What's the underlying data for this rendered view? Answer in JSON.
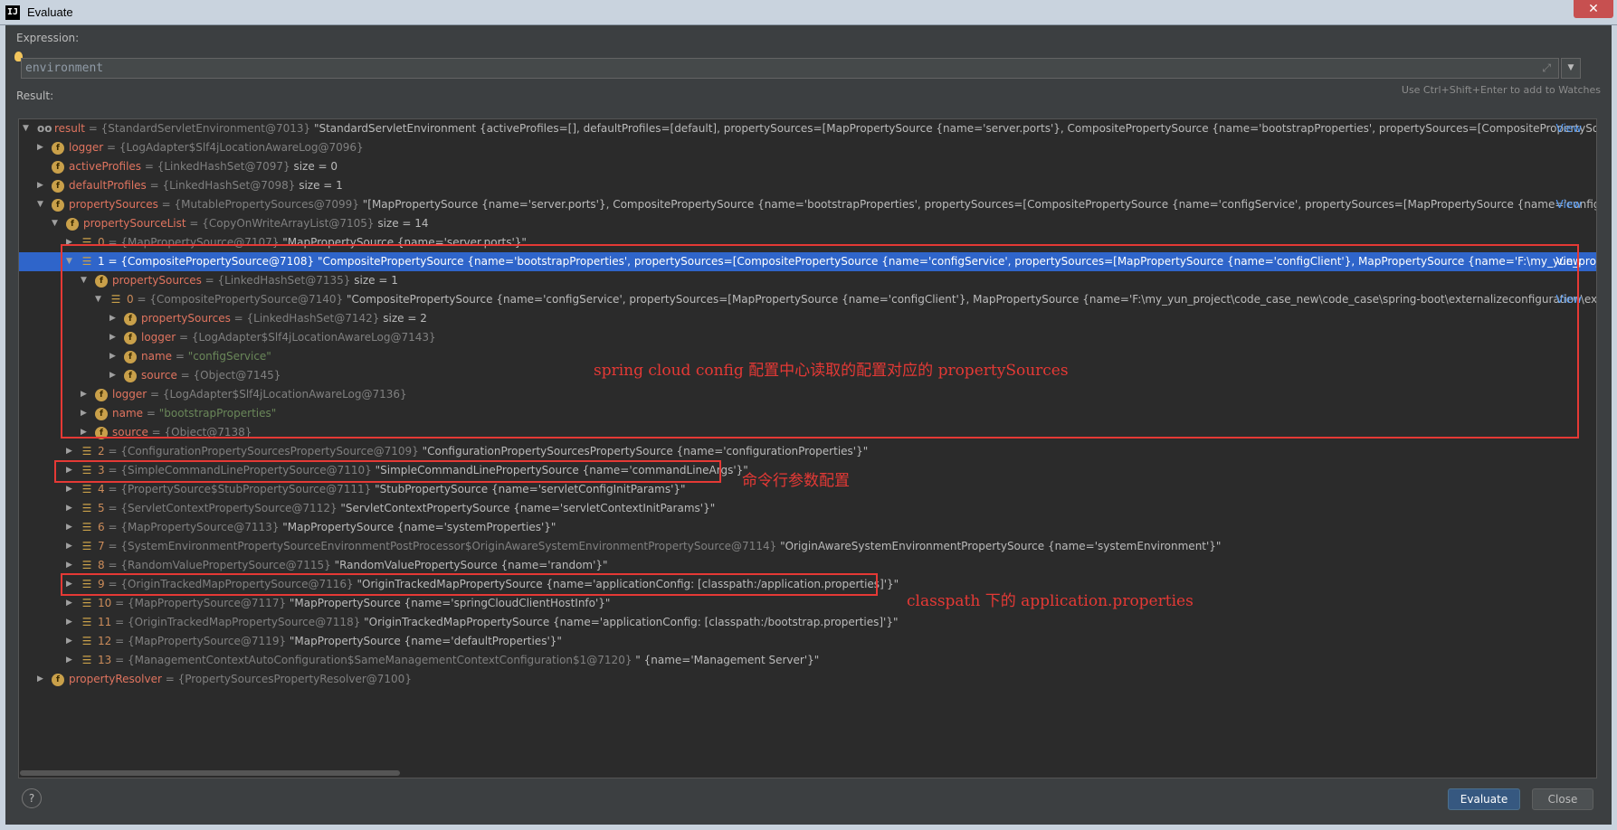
{
  "window": {
    "title": "Evaluate",
    "app_icon": "IJ",
    "close": "✕"
  },
  "expression": {
    "label": "Expression:",
    "value": "environment",
    "hint": "Use Ctrl+Shift+Enter to add to Watches"
  },
  "result_label": "Result:",
  "view_link": "View",
  "rows": [
    {
      "icon": "oo",
      "text_name": "result",
      "text_type": " = {StandardServletEnvironment@7013} ",
      "text_value": "\"StandardServletEnvironment {activeProfiles=[], defaultProfiles=[default], propertySources=[MapPropertySource {name='server.ports'}, CompositePropertySource {name='bootstrapProperties', propertySources=[CompositePropertySource {r...",
      "view": true
    },
    {
      "icon": "f",
      "text_name": "logger",
      "text_type": " = {LogAdapter$Slf4jLocationAwareLog@7096}",
      "text_value": ""
    },
    {
      "icon": "f",
      "text_name": "activeProfiles",
      "text_type": " = {LinkedHashSet@7097} ",
      "text_value": " size = 0"
    },
    {
      "icon": "f",
      "text_name": "defaultProfiles",
      "text_type": " = {LinkedHashSet@7098} ",
      "text_value": " size = 1"
    },
    {
      "icon": "f",
      "text_name": "propertySources",
      "text_type": " = {MutablePropertySources@7099} ",
      "text_value": "\"[MapPropertySource {name='server.ports'}, CompositePropertySource {name='bootstrapProperties', propertySources=[CompositePropertySource {name='configService', propertySources=[MapPropertySource {name='configClie...",
      "view": true
    },
    {
      "icon": "f",
      "text_name": "propertySourceList",
      "text_type": " = {CopyOnWriteArrayList@7105} ",
      "text_value": " size = 14"
    },
    {
      "icon": "=",
      "text_name": "0",
      "text_type": " = {MapPropertySource@7107} ",
      "text_value": "\"MapPropertySource {name='server.ports'}\""
    },
    {
      "icon": "=",
      "text_name": "1",
      "text_type": " = {CompositePropertySource@7108} ",
      "text_value": "\"CompositePropertySource {name='bootstrapProperties', propertySources=[CompositePropertySource {name='configService', propertySources=[MapPropertySource {name='configClient'}, MapPropertySource {name='F:\\my_yun_project\\...",
      "view": true
    },
    {
      "icon": "f",
      "text_name": "propertySources",
      "text_type": " = {LinkedHashSet@7135} ",
      "text_value": " size = 1"
    },
    {
      "icon": "=",
      "text_name": "0",
      "text_type": " = {CompositePropertySource@7140} ",
      "text_value": "\"CompositePropertySource {name='configService', propertySources=[MapPropertySource {name='configClient'}, MapPropertySource {name='F:\\my_yun_project\\code_case_new\\code_case\\spring-boot\\externalizeconfiguration\\ext-c...",
      "view": true
    },
    {
      "icon": "f",
      "text_name": "propertySources",
      "text_type": " = {LinkedHashSet@7142} ",
      "text_value": " size = 2"
    },
    {
      "icon": "f",
      "text_name": "logger",
      "text_type": " = {LogAdapter$Slf4jLocationAwareLog@7143}",
      "text_value": ""
    },
    {
      "icon": "f",
      "text_name": "name",
      "text_type": " = ",
      "text_value": "\"configService\""
    },
    {
      "icon": "f",
      "text_name": "source",
      "text_type": " = {Object@7145}",
      "text_value": ""
    },
    {
      "icon": "f",
      "text_name": "logger",
      "text_type": " = {LogAdapter$Slf4jLocationAwareLog@7136}",
      "text_value": ""
    },
    {
      "icon": "f",
      "text_name": "name",
      "text_type": " = ",
      "text_value": "\"bootstrapProperties\""
    },
    {
      "icon": "f",
      "text_name": "source",
      "text_type": " = {Object@7138}",
      "text_value": ""
    },
    {
      "icon": "=",
      "text_name": "2",
      "text_type": " = {ConfigurationPropertySourcesPropertySource@7109} ",
      "text_value": "\"ConfigurationPropertySourcesPropertySource {name='configurationProperties'}\""
    },
    {
      "icon": "=",
      "text_name": "3",
      "text_type": " = {SimpleCommandLinePropertySource@7110} ",
      "text_value": "\"SimpleCommandLinePropertySource {name='commandLineArgs'}\""
    },
    {
      "icon": "=",
      "text_name": "4",
      "text_type": " = {PropertySource$StubPropertySource@7111} ",
      "text_value": "\"StubPropertySource {name='servletConfigInitParams'}\""
    },
    {
      "icon": "=",
      "text_name": "5",
      "text_type": " = {ServletContextPropertySource@7112} ",
      "text_value": "\"ServletContextPropertySource {name='servletContextInitParams'}\""
    },
    {
      "icon": "=",
      "text_name": "6",
      "text_type": " = {MapPropertySource@7113} ",
      "text_value": "\"MapPropertySource {name='systemProperties'}\""
    },
    {
      "icon": "=",
      "text_name": "7",
      "text_type": " = {SystemEnvironmentPropertySourceEnvironmentPostProcessor$OriginAwareSystemEnvironmentPropertySource@7114} ",
      "text_value": "\"OriginAwareSystemEnvironmentPropertySource {name='systemEnvironment'}\""
    },
    {
      "icon": "=",
      "text_name": "8",
      "text_type": " = {RandomValuePropertySource@7115} ",
      "text_value": "\"RandomValuePropertySource {name='random'}\""
    },
    {
      "icon": "=",
      "text_name": "9",
      "text_type": " = {OriginTrackedMapPropertySource@7116} ",
      "text_value": "\"OriginTrackedMapPropertySource {name='applicationConfig: [classpath:/application.properties]'}\""
    },
    {
      "icon": "=",
      "text_name": "10",
      "text_type": " = {MapPropertySource@7117} ",
      "text_value": "\"MapPropertySource {name='springCloudClientHostInfo'}\""
    },
    {
      "icon": "=",
      "text_name": "11",
      "text_type": " = {OriginTrackedMapPropertySource@7118} ",
      "text_value": "\"OriginTrackedMapPropertySource {name='applicationConfig: [classpath:/bootstrap.properties]'}\""
    },
    {
      "icon": "=",
      "text_name": "12",
      "text_type": " = {MapPropertySource@7119} ",
      "text_value": "\"MapPropertySource {name='defaultProperties'}\""
    },
    {
      "icon": "=",
      "text_name": "13",
      "text_type": " = {ManagementContextAutoConfiguration$SameManagementContextConfiguration$1@7120} ",
      "text_value": "\" {name='Management Server'}\""
    },
    {
      "icon": "f",
      "text_name": "propertyResolver",
      "text_type": " = {PropertySourcesPropertyResolver@7100}",
      "text_value": ""
    }
  ],
  "annotations": {
    "config_center": "spring cloud config 配置中心读取的配置对应的 propertySources",
    "command_line": "命令行参数配置",
    "classpath": "classpath 下的 application.properties"
  },
  "buttons": {
    "evaluate": "Evaluate",
    "close": "Close",
    "help": "?"
  },
  "colors": {
    "selection": "#2f65ca",
    "annotation": "#e53935",
    "field_name": "#e0745f"
  }
}
